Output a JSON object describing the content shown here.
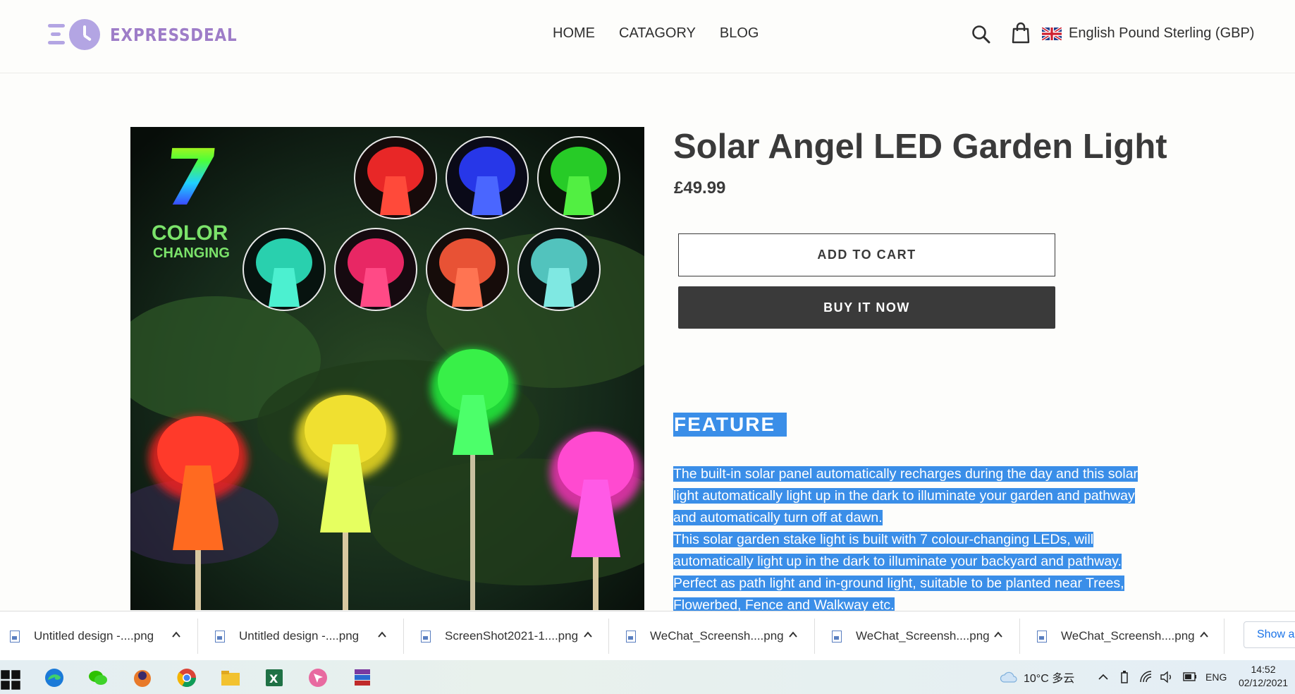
{
  "brand": {
    "name": "EXPRESSDEAL",
    "logo_color": "#b3a5e3",
    "text_color": "#9e7dc8"
  },
  "nav": {
    "items": [
      {
        "label": "HOME"
      },
      {
        "label": "CATAGORY"
      },
      {
        "label": "BLOG"
      }
    ]
  },
  "header": {
    "search_icon": "search-icon",
    "cart_icon": "shopping-bag-icon",
    "currency_label": "English Pound Sterling (GBP)"
  },
  "product": {
    "title": "Solar Angel LED Garden Light",
    "price": "£49.99",
    "add_to_cart": "ADD TO CART",
    "buy_now": "BUY IT NOW",
    "image": {
      "badge_number": "7",
      "badge_line1": "COLOR",
      "badge_line2": "CHANGING"
    },
    "feature_heading": "FEATURE",
    "description_lines": [
      "The built-in solar panel automatically recharges during the day and this solar",
      "light automatically light up in the dark to illuminate your garden and pathway",
      "and automatically turn off at dawn.",
      "This solar garden stake light is built with 7 colour-changing LEDs, will",
      "automatically light up in the dark to illuminate your backyard and pathway.",
      "Perfect as path light and in-ground light, suitable to be planted near Trees,",
      "Flowerbed, Fence and Walkway etc."
    ],
    "selection_color": "#3a8ee8"
  },
  "downloads": {
    "items": [
      {
        "name": "Untitled design -....png"
      },
      {
        "name": "Untitled design -....png"
      },
      {
        "name": "ScreenShot2021-1....png"
      },
      {
        "name": "WeChat_Screensh....png"
      },
      {
        "name": "WeChat_Screensh....png"
      },
      {
        "name": "WeChat_Screensh....png"
      }
    ],
    "show_all": "Show all"
  },
  "taskbar": {
    "apps": [
      "windows-start-icon",
      "edge-icon",
      "wechat-icon",
      "app-icon",
      "chrome-icon",
      "file-explorer-icon",
      "excel-icon",
      "arrow-app-icon",
      "winrar-icon"
    ],
    "weather": "10°C 多云",
    "language": "ENG",
    "time": "14:52",
    "date": "02/12/2021"
  }
}
